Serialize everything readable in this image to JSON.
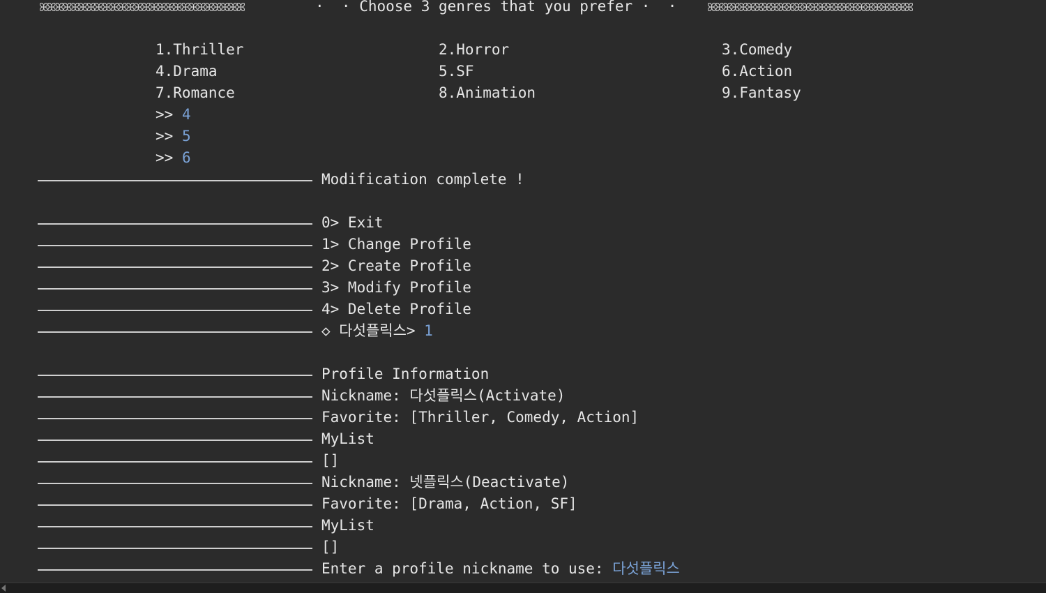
{
  "header": {
    "left_decoration": "ꕤꕤꕤꕤꕤꕤꕤꕤꕤꕤꕤꕤꕤꕤꕤꕤꕤꕤꕤꕤꕤꕤꕤꕤꕤꕤ",
    "right_decoration": "ꕤꕤꕤꕤꕤꕤꕤꕤꕤꕤꕤꕤꕤꕤꕤꕤꕤꕤꕤꕤꕤꕤꕤꕤꕤꕤ",
    "title": "·  · Choose 3 genres that you prefer ·  ·"
  },
  "genres": [
    "1.Thriller",
    "2.Horror",
    "3.Comedy",
    "4.Drama",
    "5.SF",
    "6.Action",
    "7.Romance",
    "8.Animation",
    "9.Fantasy"
  ],
  "genre_inputs": {
    "prompt": ">> ",
    "values": [
      "4",
      "5",
      "6"
    ]
  },
  "messages": {
    "modification_complete": "Modification complete !"
  },
  "menu": {
    "items": [
      "0> Exit",
      "1> Change Profile",
      "2> Create Profile",
      "3> Modify Profile",
      "4> Delete Profile"
    ],
    "prompt": "◇ 다섯플릭스> ",
    "input": "1"
  },
  "profile_info": {
    "title": "Profile Information",
    "profiles": [
      {
        "nickname": "Nickname: 다섯플릭스(Activate)",
        "favorite": "Favorite: [Thriller, Comedy, Action]",
        "mylist_label": "MyList",
        "mylist": "[]"
      },
      {
        "nickname": "Nickname: 넷플릭스(Deactivate)",
        "favorite": "Favorite: [Drama, Action, SF]",
        "mylist_label": "MyList",
        "mylist": "[]"
      }
    ]
  },
  "nickname_prompt": {
    "label": "Enter a profile nickname to use: ",
    "input": "다섯플릭스"
  },
  "colors": {
    "background": "#2b2b2b",
    "text": "#e6e6e6",
    "input": "#7aa2d6"
  }
}
